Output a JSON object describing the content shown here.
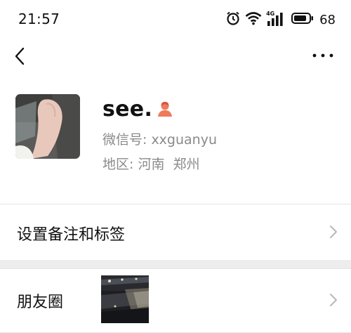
{
  "status_bar": {
    "time": "21:57",
    "battery_level": "68",
    "network_label": "4G",
    "icons": [
      "alarm-icon",
      "wifi-icon",
      "cellular-signal-icon",
      "battery-icon"
    ]
  },
  "nav": {
    "back_icon": "chevron-left-icon",
    "more_icon": "more-dots-icon"
  },
  "profile": {
    "nickname": "see.",
    "gender_icon": "female-person-icon",
    "gender_color": "#f07a5d",
    "wechat_id_label": "微信号: xxguanyu",
    "region_label": "地区: 河南  郑州"
  },
  "cells": {
    "remark_label": "设置备注和标签",
    "moments_label": "朋友圈"
  },
  "colors": {
    "background": "#ffffff",
    "secondary_text": "#8a8a8a",
    "chevron": "#b8b8b8",
    "section_gap": "#ededed"
  }
}
